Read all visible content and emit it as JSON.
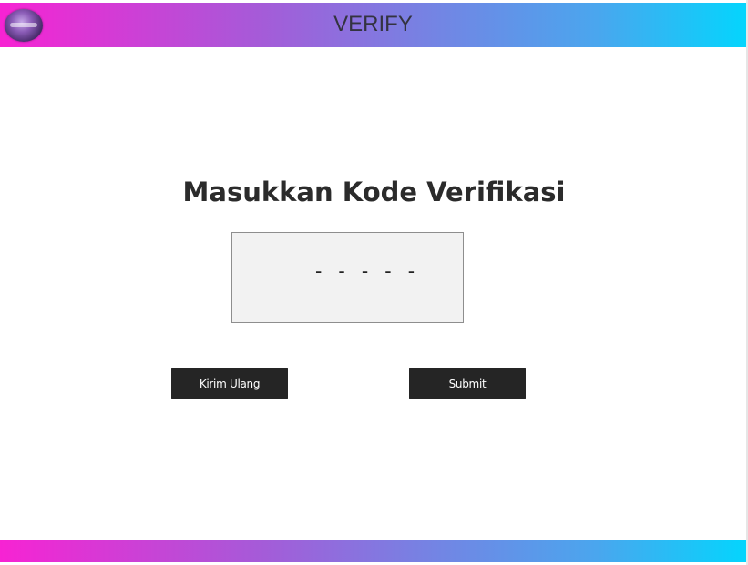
{
  "header": {
    "title": "VERIFY",
    "logo_icon": "globe-logo-icon"
  },
  "main": {
    "heading": "Masukkan Kode Verifikasi",
    "code_input": {
      "value": "",
      "placeholder": "- - - - -"
    },
    "buttons": {
      "resend_label": "Kirim Ulang",
      "submit_label": "Submit"
    }
  },
  "colors": {
    "gradient_start": "#f723d3",
    "gradient_end": "#04d5fd",
    "button_bg": "#252525",
    "input_bg": "#f2f2f2"
  }
}
